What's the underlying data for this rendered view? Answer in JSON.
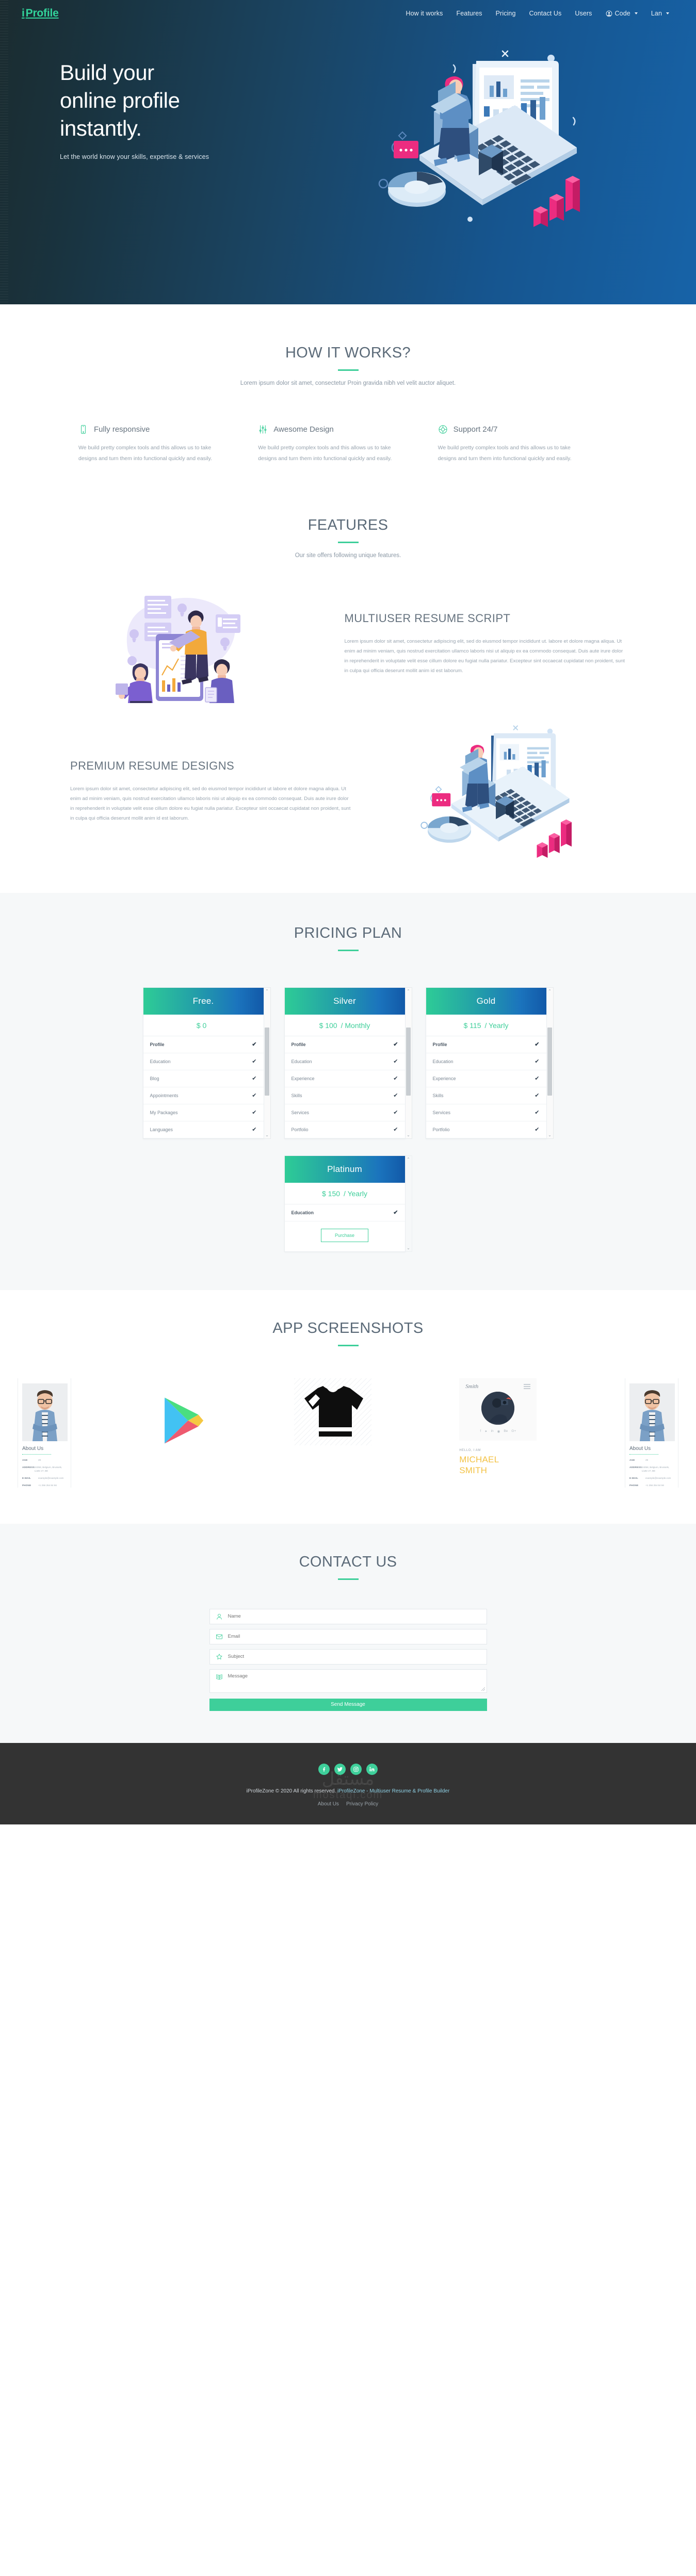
{
  "nav": {
    "brand": "iProfile",
    "brand_i": "i",
    "brand_rest": "Profile",
    "links": [
      {
        "label": "How it works"
      },
      {
        "label": "Features"
      },
      {
        "label": "Pricing"
      },
      {
        "label": "Contact Us"
      },
      {
        "label": "Users"
      }
    ],
    "code_label": "Code",
    "lang_label": "Lan"
  },
  "hero": {
    "title_line1": "Build your",
    "title_line2": "online profile",
    "title_line3": "instantly.",
    "subtitle": "Let the world know your skills, expertise & services"
  },
  "how_it_works": {
    "title": "HOW IT WORKS?",
    "lead": "Lorem ipsum dolor sit amet, consectetur Proin gravida nibh vel velit auctor aliquet.",
    "items": [
      {
        "icon": "mobile-icon",
        "title": "Fully responsive",
        "text": "We build pretty complex tools and this allows us to take designs and turn them into functional quickly and easily."
      },
      {
        "icon": "sliders-icon",
        "title": "Awesome Design",
        "text": "We build pretty complex tools and this allows us to take designs and turn them into functional quickly and easily."
      },
      {
        "icon": "lifebuoy-icon",
        "title": "Support 24/7",
        "text": "We build pretty complex tools and this allows us to take designs and turn them into functional quickly and easily."
      }
    ]
  },
  "features": {
    "title": "FEATURES",
    "lead": "Our site offers following unique features.",
    "block1": {
      "heading": "MULTIUSER RESUME SCRIPT",
      "text": "Lorem ipsum dolor sit amet, consectetur adipiscing elit, sed do eiusmod tempor incididunt ut. labore et dolore magna aliqua. Ut enim ad minim veniam, quis nostrud exercitation ullamco laboris nisi ut aliquip ex ea commodo consequat. Duis aute irure dolor in reprehenderit in voluptate velit esse cillum dolore eu fugiat nulla pariatur. Excepteur sint occaecat cupidatat non proident, sunt in culpa qui officia deserunt mollit anim id est laborum."
    },
    "block2": {
      "heading": "PREMIUM RESUME DESIGNS",
      "text": "Lorem ipsum dolor sit amet, consectetur adipiscing elit, sed do eiusmod tempor incididunt ut labore et dolore magna aliqua. Ut enim ad minim veniam, quis nostrud exercitation ullamco laboris nisi ut aliquip ex ea commodo consequat. Duis aute irure dolor in reprehenderit in voluptate velit esse cillum dolore eu fugiat nulla pariatur. Excepteur sint occaecat cupidatat non proident, sunt in culpa qui officia deserunt mollit anim id est laborum."
    }
  },
  "pricing": {
    "title": "PRICING PLAN",
    "purchase_label": "Purchase",
    "plans": [
      {
        "name": "Free.",
        "price": "$ 0",
        "period": "",
        "features": [
          {
            "label": "Profile",
            "included": true
          },
          {
            "label": "Education",
            "included": true
          },
          {
            "label": "Blog",
            "included": true
          },
          {
            "label": "Appointments",
            "included": true
          },
          {
            "label": "My Packages",
            "included": true
          },
          {
            "label": "Languages",
            "included": true
          }
        ]
      },
      {
        "name": "Silver",
        "price": "$ 100",
        "period": "/ Monthly",
        "features": [
          {
            "label": "Profile",
            "included": true
          },
          {
            "label": "Education",
            "included": true
          },
          {
            "label": "Experience",
            "included": true
          },
          {
            "label": "Skills",
            "included": true
          },
          {
            "label": "Services",
            "included": true
          },
          {
            "label": "Portfolio",
            "included": true
          }
        ]
      },
      {
        "name": "Gold",
        "price": "$ 115",
        "period": "/ Yearly",
        "features": [
          {
            "label": "Profile",
            "included": true
          },
          {
            "label": "Education",
            "included": true
          },
          {
            "label": "Experience",
            "included": true
          },
          {
            "label": "Skills",
            "included": true
          },
          {
            "label": "Services",
            "included": true
          },
          {
            "label": "Portfolio",
            "included": true
          }
        ]
      }
    ],
    "platinum": {
      "name": "Platinum",
      "price": "$ 150",
      "period": "/ Yearly",
      "features": [
        {
          "label": "Education",
          "included": true
        }
      ]
    }
  },
  "app_screenshots": {
    "title": "APP SCREENSHOTS",
    "profile_card": {
      "about_title": "About Us",
      "rows": [
        {
          "key": "AGE",
          "value": "29"
        },
        {
          "key": "ADDRESS",
          "value": "24058, Belgium, Brussels, Liutte 27, BE"
        },
        {
          "key": "E-MAIL",
          "value": "example@example.com"
        },
        {
          "key": "PHONE",
          "value": "+1 256 254 84 56"
        }
      ]
    },
    "smith_card": {
      "logo": "Smith",
      "hello": "HELLO, I AM",
      "name_line1": "MICHAEL",
      "name_line2": "SMITH",
      "socials": [
        "f",
        "t",
        "in",
        "d",
        "Be",
        "G+"
      ]
    },
    "icons": [
      "google-play-icon",
      "tshirt-icon"
    ]
  },
  "contact": {
    "title": "CONTACT US",
    "fields": [
      {
        "icon": "user-icon",
        "placeholder": "Name",
        "value": ""
      },
      {
        "icon": "envelope-icon",
        "placeholder": "Email",
        "value": ""
      },
      {
        "icon": "star-icon",
        "placeholder": "Subject",
        "value": ""
      },
      {
        "icon": "book-icon",
        "placeholder": "Message",
        "value": ""
      }
    ],
    "submit_label": "Send Message"
  },
  "footer": {
    "socials": [
      {
        "name": "facebook-icon",
        "glyph": "f"
      },
      {
        "name": "twitter-icon",
        "glyph": "t"
      },
      {
        "name": "instagram-icon",
        "glyph": "◉"
      },
      {
        "name": "linkedin-icon",
        "glyph": "in"
      }
    ],
    "copyright": "iProfileZone © 2020 All rights reserved.",
    "tagline": "iProfileZone - Multiuser Resume & Profile Builder",
    "links": [
      {
        "label": "About Us"
      },
      {
        "label": "Privacy Policy"
      }
    ],
    "watermark_line1": "مستقل",
    "watermark_line2": "mostaql.com"
  },
  "colors": {
    "accent": "#3ecf9a",
    "hero_dark": "#1b2c30",
    "hero_blue": "#1763a8",
    "footer_bg": "#333333",
    "heading": "#5b6a78",
    "pink": "#ec2c80"
  }
}
